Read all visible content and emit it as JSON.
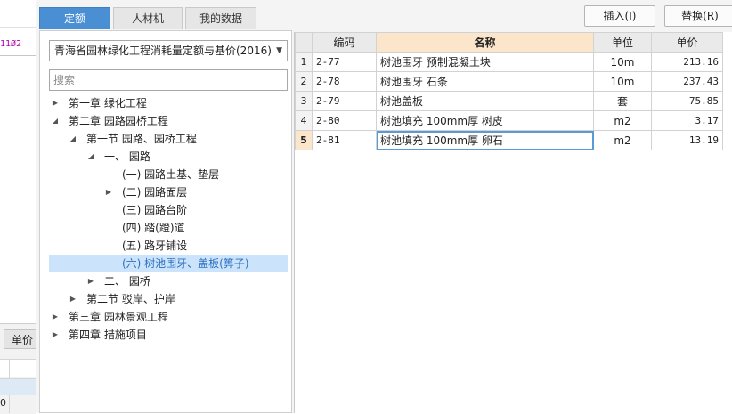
{
  "background": {
    "code_fragment": "11Ø2",
    "unit_tab_label": "单价",
    "cell_value": "0"
  },
  "tabs": [
    {
      "label": "定额",
      "active": true
    },
    {
      "label": "人材机",
      "active": false
    },
    {
      "label": "我的数据",
      "active": false
    }
  ],
  "quota_select": {
    "value": "青海省园林绿化工程消耗量定额与基价(2016)"
  },
  "search": {
    "placeholder": "搜索"
  },
  "tree": [
    {
      "label": "第一章 绿化工程",
      "state": "collapsed"
    },
    {
      "label": "第二章 园路园桥工程",
      "state": "expanded"
    },
    {
      "label": "第一节 园路、园桥工程",
      "state": "expanded"
    },
    {
      "label": "一、 园路",
      "state": "expanded"
    },
    {
      "label": "(一) 园路土基、垫层",
      "state": "leaf"
    },
    {
      "label": "(二) 园路面层",
      "state": "collapsed"
    },
    {
      "label": "(三) 园路台阶",
      "state": "leaf"
    },
    {
      "label": "(四) 踏(蹬)道",
      "state": "leaf"
    },
    {
      "label": "(五) 路牙铺设",
      "state": "leaf"
    },
    {
      "label": "(六) 树池围牙、盖板(箅子)",
      "state": "selected"
    },
    {
      "label": "二、 园桥",
      "state": "collapsed"
    },
    {
      "label": "第二节 驳岸、护岸",
      "state": "collapsed"
    },
    {
      "label": "第三章 园林景观工程",
      "state": "collapsed"
    },
    {
      "label": "第四章 措施项目",
      "state": "collapsed"
    }
  ],
  "buttons": {
    "insert": "插入(I)",
    "replace": "替换(R)"
  },
  "table": {
    "headers": [
      "编码",
      "名称",
      "单位",
      "单价"
    ],
    "rows": [
      {
        "no": "1",
        "code": "2-77",
        "name": "树池围牙 预制混凝土块",
        "unit": "10m",
        "price": "213.16"
      },
      {
        "no": "2",
        "code": "2-78",
        "name": "树池围牙 石条",
        "unit": "10m",
        "price": "237.43"
      },
      {
        "no": "3",
        "code": "2-79",
        "name": "树池盖板",
        "unit": "套",
        "price": "75.85"
      },
      {
        "no": "4",
        "code": "2-80",
        "name": "树池填充 100mm厚 树皮",
        "unit": "m2",
        "price": "3.17"
      },
      {
        "no": "5",
        "code": "2-81",
        "name": "树池填充 100mm厚 卵石",
        "unit": "m2",
        "price": "13.19"
      }
    ]
  }
}
